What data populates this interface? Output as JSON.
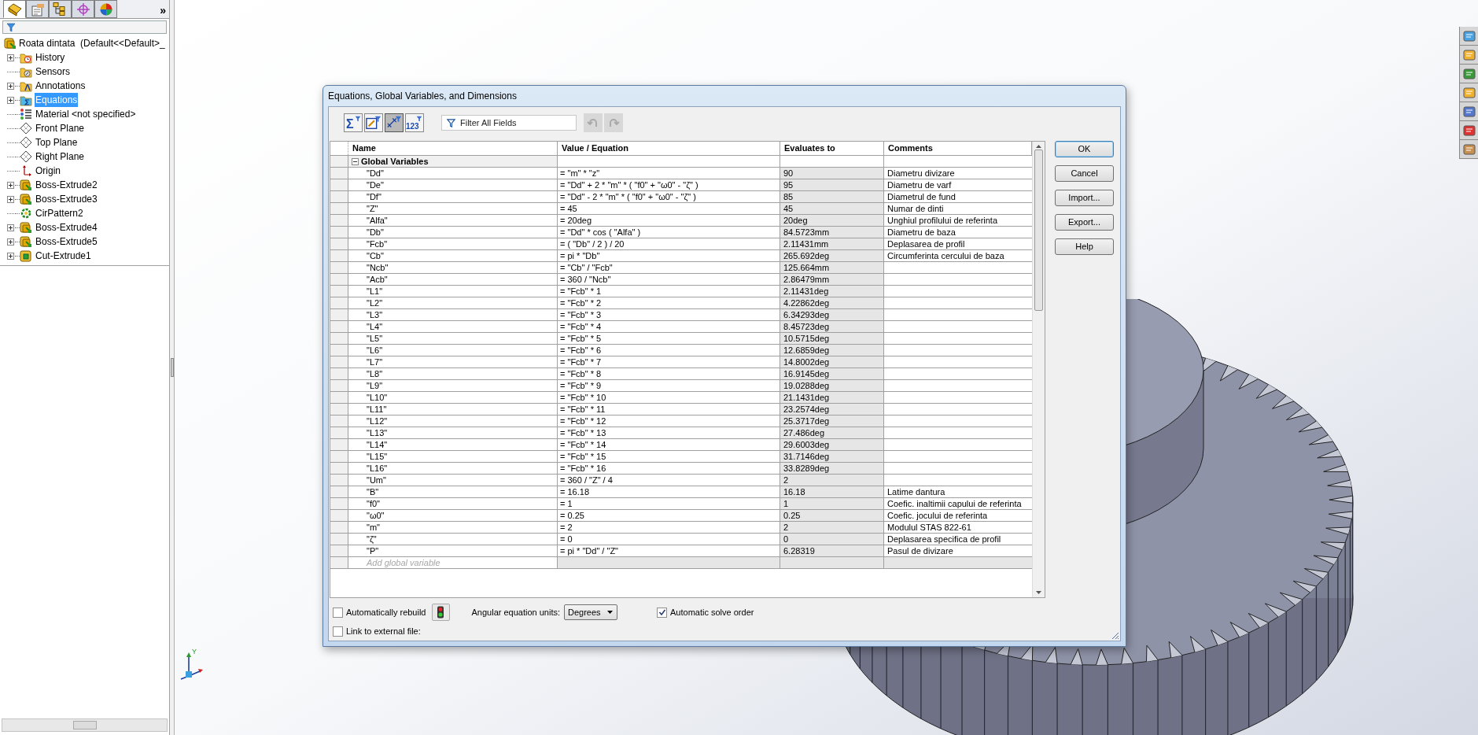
{
  "panel_tabs": [
    {
      "kind": "feature",
      "selected": true
    },
    {
      "kind": "property",
      "selected": false
    },
    {
      "kind": "config",
      "selected": false
    },
    {
      "kind": "dimxpert",
      "selected": false
    },
    {
      "kind": "display",
      "selected": false
    }
  ],
  "panel_more": "»",
  "feature_tree": {
    "root": "Roata dintata  (Default<<Default>_",
    "items": [
      {
        "label": "History",
        "kind": "history",
        "expandable": true,
        "selected": false
      },
      {
        "label": "Sensors",
        "kind": "sensors",
        "expandable": false,
        "selected": false
      },
      {
        "label": "Annotations",
        "kind": "annotations",
        "expandable": true,
        "selected": false
      },
      {
        "label": "Equations",
        "kind": "equations",
        "expandable": true,
        "selected": true
      },
      {
        "label": "Material <not specified>",
        "kind": "material",
        "expandable": false,
        "selected": false
      },
      {
        "label": "Front Plane",
        "kind": "plane",
        "expandable": false,
        "selected": false
      },
      {
        "label": "Top Plane",
        "kind": "plane",
        "expandable": false,
        "selected": false
      },
      {
        "label": "Right Plane",
        "kind": "plane",
        "expandable": false,
        "selected": false
      },
      {
        "label": "Origin",
        "kind": "origin",
        "expandable": false,
        "selected": false
      },
      {
        "label": "Boss-Extrude2",
        "kind": "extrude",
        "expandable": true,
        "selected": false
      },
      {
        "label": "Boss-Extrude3",
        "kind": "extrude",
        "expandable": true,
        "selected": false
      },
      {
        "label": "CirPattern2",
        "kind": "pattern",
        "expandable": false,
        "selected": false
      },
      {
        "label": "Boss-Extrude4",
        "kind": "extrude",
        "expandable": true,
        "selected": false
      },
      {
        "label": "Boss-Extrude5",
        "kind": "extrude",
        "expandable": true,
        "selected": false
      },
      {
        "label": "Cut-Extrude1",
        "kind": "cut",
        "expandable": true,
        "selected": false
      }
    ]
  },
  "triad": {
    "label": "Y"
  },
  "dialog": {
    "title": "Equations, Global Variables, and Dimensions",
    "views": [
      {
        "kind": "equation",
        "label": "Σ",
        "selected": false
      },
      {
        "kind": "sketch",
        "selected": false
      },
      {
        "kind": "dimension",
        "selected": true
      },
      {
        "kind": "ordered",
        "label": "123",
        "selected": false
      }
    ],
    "filter": {
      "placeholder": "Filter All Fields"
    },
    "undo": {
      "disabled": true
    },
    "redo": {
      "disabled": true
    },
    "columns": [
      "Name",
      "Value / Equation",
      "Evaluates to",
      "Comments"
    ],
    "group": {
      "label": "Global Variables",
      "expanded": true
    },
    "rows": [
      {
        "name": "\"Dd\"",
        "value": "= \"m\" * \"z\"",
        "result": "90",
        "comment": "Diametru divizare"
      },
      {
        "name": "\"De\"",
        "value": "= \"Dd\" + 2 * \"m\" * ( \"f0\" + \"ω0\" - \"ζ\" )",
        "result": "95",
        "comment": "Diametru de varf"
      },
      {
        "name": "\"Df\"",
        "value": "= \"Dd\" - 2 * \"m\" * ( \"f0\" + \"ω0\" - \"ζ\" )",
        "result": "85",
        "comment": "Diametrul de fund"
      },
      {
        "name": "\"Z\"",
        "value": "= 45",
        "result": "45",
        "comment": "Numar de dinti"
      },
      {
        "name": "\"Alfa\"",
        "value": "= 20deg",
        "result": "20deg",
        "comment": "Unghiul profilului de referinta"
      },
      {
        "name": "\"Db\"",
        "value": "= \"Dd\" * cos ( \"Alfa\" )",
        "result": "84.5723mm",
        "comment": "Diametru de baza"
      },
      {
        "name": "\"Fcb\"",
        "value": "= ( \"Db\" / 2 ) / 20",
        "result": "2.11431mm",
        "comment": "Deplasarea de profil"
      },
      {
        "name": "\"Cb\"",
        "value": "= pi * \"Db\"",
        "result": "265.692deg",
        "comment": "Circumferinta cercului de baza"
      },
      {
        "name": "\"Ncb\"",
        "value": "= \"Cb\" / \"Fcb\"",
        "result": "125.664mm"
      },
      {
        "name": "\"Acb\"",
        "value": "= 360 / \"Ncb\"",
        "result": "2.86479mm"
      },
      {
        "name": "\"L1\"",
        "value": "= \"Fcb\" * 1",
        "result": "2.11431deg"
      },
      {
        "name": "\"L2\"",
        "value": "= \"Fcb\" * 2",
        "result": "4.22862deg"
      },
      {
        "name": "\"L3\"",
        "value": "= \"Fcb\" * 3",
        "result": "6.34293deg"
      },
      {
        "name": "\"L4\"",
        "value": "= \"Fcb\" * 4",
        "result": "8.45723deg"
      },
      {
        "name": "\"L5\"",
        "value": "= \"Fcb\" * 5",
        "result": "10.5715deg"
      },
      {
        "name": "\"L6\"",
        "value": "= \"Fcb\" * 6",
        "result": "12.6859deg"
      },
      {
        "name": "\"L7\"",
        "value": "= \"Fcb\" * 7",
        "result": "14.8002deg"
      },
      {
        "name": "\"L8\"",
        "value": "= \"Fcb\" * 8",
        "result": "16.9145deg"
      },
      {
        "name": "\"L9\"",
        "value": "= \"Fcb\" * 9",
        "result": "19.0288deg"
      },
      {
        "name": "\"L10\"",
        "value": "= \"Fcb\" * 10",
        "result": "21.1431deg"
      },
      {
        "name": "\"L11\"",
        "value": "= \"Fcb\" * 11",
        "result": "23.2574deg"
      },
      {
        "name": "\"L12\"",
        "value": "= \"Fcb\" * 12",
        "result": "25.3717deg"
      },
      {
        "name": "\"L13\"",
        "value": "= \"Fcb\" * 13",
        "result": "27.486deg"
      },
      {
        "name": "\"L14\"",
        "value": "= \"Fcb\" * 14",
        "result": "29.6003deg"
      },
      {
        "name": "\"L15\"",
        "value": "= \"Fcb\" * 15",
        "result": "31.7146deg"
      },
      {
        "name": "\"L16\"",
        "value": "= \"Fcb\" * 16",
        "result": "33.8289deg"
      },
      {
        "name": "\"Um\"",
        "value": "= 360 / \"Z\" / 4",
        "result": "2"
      },
      {
        "name": "\"B\"",
        "value": "= 16.18",
        "result": "16.18",
        "comment": "Latime dantura"
      },
      {
        "name": "\"f0\"",
        "value": "= 1",
        "result": "1",
        "comment": "Coefic. inaltimii capului de referinta"
      },
      {
        "name": "\"ω0\"",
        "value": "= 0.25",
        "result": "0.25",
        "comment": "Coefic. jocului de referinta"
      },
      {
        "name": "\"m\"",
        "value": "= 2",
        "result": "2",
        "comment": "Modulul STAS 822-61"
      },
      {
        "name": "\"ζ\"",
        "value": "= 0",
        "result": "0",
        "comment": "Deplasarea specifica de profil"
      },
      {
        "name": "\"P\"",
        "value": "= pi * \"Dd\" / \"Z\"",
        "result": "6.28319",
        "comment": "Pasul de divizare"
      }
    ],
    "add_placeholder": "Add global variable",
    "buttons": [
      {
        "label": "OK",
        "default": true
      },
      {
        "label": "Cancel",
        "default": false
      },
      {
        "label": "Import...",
        "default": false
      },
      {
        "label": "Export...",
        "default": false
      },
      {
        "label": "Help",
        "default": false
      }
    ],
    "auto_rebuild": {
      "label": "Automatically rebuild",
      "checked": false
    },
    "angular_units": {
      "label": "Angular equation units:",
      "value": "Degrees"
    },
    "auto_solve": {
      "label": "Automatic solve order",
      "checked": true
    },
    "link_file": {
      "label": "Link to external file:",
      "checked": false
    }
  }
}
